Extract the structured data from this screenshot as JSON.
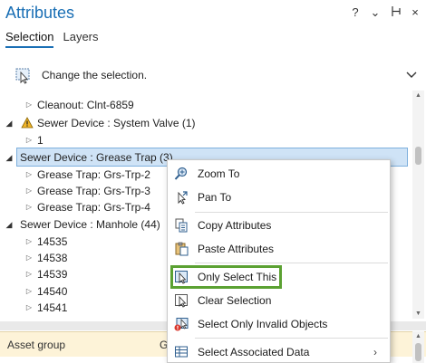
{
  "pane": {
    "title": "Attributes",
    "controls": [
      "?",
      "⌄",
      "⊣",
      "×"
    ]
  },
  "tabs": [
    {
      "label": "Selection",
      "active": true
    },
    {
      "label": "Layers",
      "active": false
    }
  ],
  "change_selection": {
    "label": "Change the selection.",
    "icon": "select-by-rectangle-icon"
  },
  "tree": {
    "rows": [
      {
        "label": "Cleanout: Clnt-6859",
        "expander": "collapsed"
      },
      {
        "label": "Sewer Device : System Valve (1)",
        "expander": "expanded",
        "icon": "warning-icon"
      },
      {
        "label": "1",
        "expander": "collapsed"
      },
      {
        "label": "Sewer Device : Grease Trap (3)",
        "expander": "expanded",
        "selected": true
      },
      {
        "label": "Grease Trap: Grs-Trp-2",
        "expander": "collapsed"
      },
      {
        "label": "Grease Trap: Grs-Trp-3",
        "expander": "collapsed"
      },
      {
        "label": "Grease Trap: Grs-Trp-4",
        "expander": "collapsed"
      },
      {
        "label": "Sewer Device : Manhole (44)",
        "expander": "expanded"
      },
      {
        "label": "14535",
        "expander": "collapsed"
      },
      {
        "label": "14538",
        "expander": "collapsed"
      },
      {
        "label": "14539",
        "expander": "collapsed"
      },
      {
        "label": "14540",
        "expander": "collapsed"
      },
      {
        "label": "14541",
        "expander": "collapsed"
      }
    ]
  },
  "bottom": {
    "asset_label": "Asset group",
    "asset_value": "G"
  },
  "context_menu": {
    "items": [
      {
        "label": "Zoom To",
        "icon": "zoom-to-icon"
      },
      {
        "label": "Pan To",
        "icon": "pan-to-icon"
      },
      {
        "label": "Copy Attributes",
        "icon": "copy-icon"
      },
      {
        "label": "Paste Attributes",
        "icon": "paste-icon"
      },
      {
        "label": "Only Select This",
        "icon": "only-select-icon",
        "highlighted": true
      },
      {
        "label": "Clear Selection",
        "icon": "clear-selection-icon"
      },
      {
        "label": "Select Only Invalid Objects",
        "icon": "invalid-objects-icon"
      },
      {
        "label": "Select Associated Data",
        "icon": "associated-data-icon",
        "submenu": "›"
      }
    ],
    "highlight_color": "#5ba132"
  },
  "colors": {
    "title": "#1a6fb5",
    "selected_row": "#cfe3f6",
    "asset_row": "#fdf3d8"
  }
}
